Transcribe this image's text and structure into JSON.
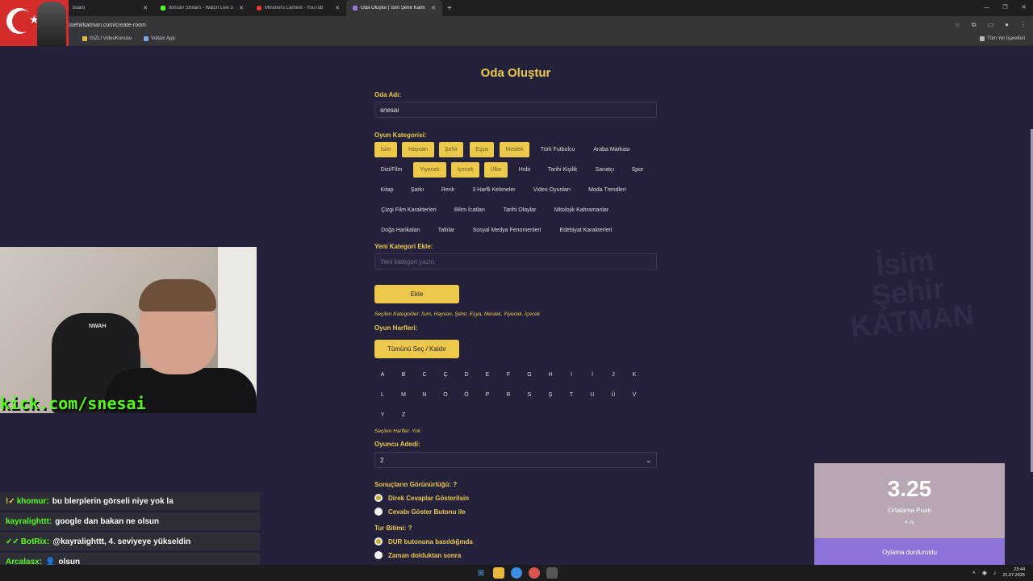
{
  "browser": {
    "tabs": [
      {
        "label": "board",
        "color": "#3a3a3a"
      },
      {
        "label": "İkinsan Stream - Watch Live o",
        "color": "#53fc18"
      },
      {
        "label": "Minstrel's Lament - YouTub",
        "color": "#ff3b3b"
      },
      {
        "label": "Oda Oluştur | İsim Şehir Katm",
        "color": "#9b7ad6"
      }
    ],
    "url": "msehirkatman.com/create-room",
    "bookmarks": [
      "GİZLİ VideoKonusu",
      "Voltaic App"
    ],
    "all_bookmarks": "Tüm Yer İşaretleri"
  },
  "form": {
    "title": "Oda Oluştur",
    "room_name_label": "Oda Adı:",
    "room_name_value": "snesai",
    "category_label": "Oyun Kategorisi:",
    "categories": [
      {
        "name": "İsim",
        "selected": true
      },
      {
        "name": "Hayvan",
        "selected": true
      },
      {
        "name": "Şehir",
        "selected": true
      },
      {
        "name": "Eşya",
        "selected": true
      },
      {
        "name": "Meslek",
        "selected": true
      },
      {
        "name": "Türk Futbolcu",
        "selected": false
      },
      {
        "name": "Araba Markası",
        "selected": false
      },
      {
        "name": "Dizi/Film",
        "selected": false
      },
      {
        "name": "Yiyecek",
        "selected": true
      },
      {
        "name": "İçecek",
        "selected": true
      },
      {
        "name": "Ülke",
        "selected": true
      },
      {
        "name": "Hobi",
        "selected": false
      },
      {
        "name": "Tarihi Kişilik",
        "selected": false
      },
      {
        "name": "Sanatçı",
        "selected": false
      },
      {
        "name": "Spor",
        "selected": false
      },
      {
        "name": "Kitap",
        "selected": false
      },
      {
        "name": "Şarkı",
        "selected": false
      },
      {
        "name": "Renk",
        "selected": false
      },
      {
        "name": "3 Harfli Kelimeler",
        "selected": false
      },
      {
        "name": "Video Oyunları",
        "selected": false
      },
      {
        "name": "Moda Trendleri",
        "selected": false
      },
      {
        "name": "Çizgi Film Karakterleri",
        "selected": false
      },
      {
        "name": "Bilim İcatları",
        "selected": false
      },
      {
        "name": "Tarihi Olaylar",
        "selected": false
      },
      {
        "name": "Mitolojik Kahramanlar",
        "selected": false
      },
      {
        "name": "Doğa Harikaları",
        "selected": false
      },
      {
        "name": "Tatlılar",
        "selected": false
      },
      {
        "name": "Sosyal Medya Fenomenleri",
        "selected": false
      },
      {
        "name": "Edebiyat Karakterleri",
        "selected": false
      }
    ],
    "new_category_label": "Yeni Kategori Ekle:",
    "new_category_placeholder": "Yeni kategori yazın",
    "add_button": "Ekle",
    "selected_categories_note": "Seçilen Kategoriler: İsim, Hayvan, Şehir, Eşya, Meslek, Yiyecek, İçecek",
    "letters_label": "Oyun Harfleri:",
    "select_all_button": "Tümünü Seç / Kaldır",
    "letters": [
      "A",
      "B",
      "C",
      "Ç",
      "D",
      "E",
      "F",
      "G",
      "H",
      "I",
      "İ",
      "J",
      "K",
      "L",
      "M",
      "N",
      "O",
      "Ö",
      "P",
      "R",
      "S",
      "Ş",
      "T",
      "U",
      "Ü",
      "V",
      "Y",
      "Z"
    ],
    "selected_letters_note": "Seçilen Harfler: Yok",
    "player_count_label": "Oyuncu Adedi:",
    "player_count_value": "2",
    "visibility_label": "Sonuçların Görünürlüğü:  ?",
    "visibility_options": [
      {
        "label": "Direk Cevaplar Gösterilsin",
        "checked": true
      },
      {
        "label": "Cevabı Göster Butonu ile",
        "checked": false
      }
    ],
    "round_end_label": "Tur Bitimi:  ?",
    "round_end_options": [
      {
        "label": "DUR butonuna basıldığında",
        "checked": true
      },
      {
        "label": "Zaman dolduktan sonra",
        "checked": false
      }
    ]
  },
  "watermark": [
    "İsim",
    "Şehir",
    "KATMAN"
  ],
  "stream": {
    "kick_handle": "kick.com/snesai",
    "chair_text": "NWAH",
    "chat": [
      {
        "user": "khomur:",
        "message": "bu blerplerin görseli niye yok la",
        "color": "#53fc18",
        "badge": "!✓"
      },
      {
        "user": "kayralighttt:",
        "message": "google dan bakan ne olsun",
        "color": "#53fc18",
        "badge": ""
      },
      {
        "user": "BotRix:",
        "message": "@kayralighttt, 4. seviyeye yükseldin",
        "color": "#53fc18",
        "badge": "✓✓"
      },
      {
        "user": "Arcalasx:",
        "message": "olsun",
        "color": "#53fc18",
        "badge": ""
      }
    ]
  },
  "rating": {
    "score": "3.25",
    "label": "Ortalama Puan",
    "votes": "4 oy",
    "status": "Oylama durduruldu"
  },
  "taskbar": {
    "time": "23:44",
    "date": "21.07.2025"
  }
}
